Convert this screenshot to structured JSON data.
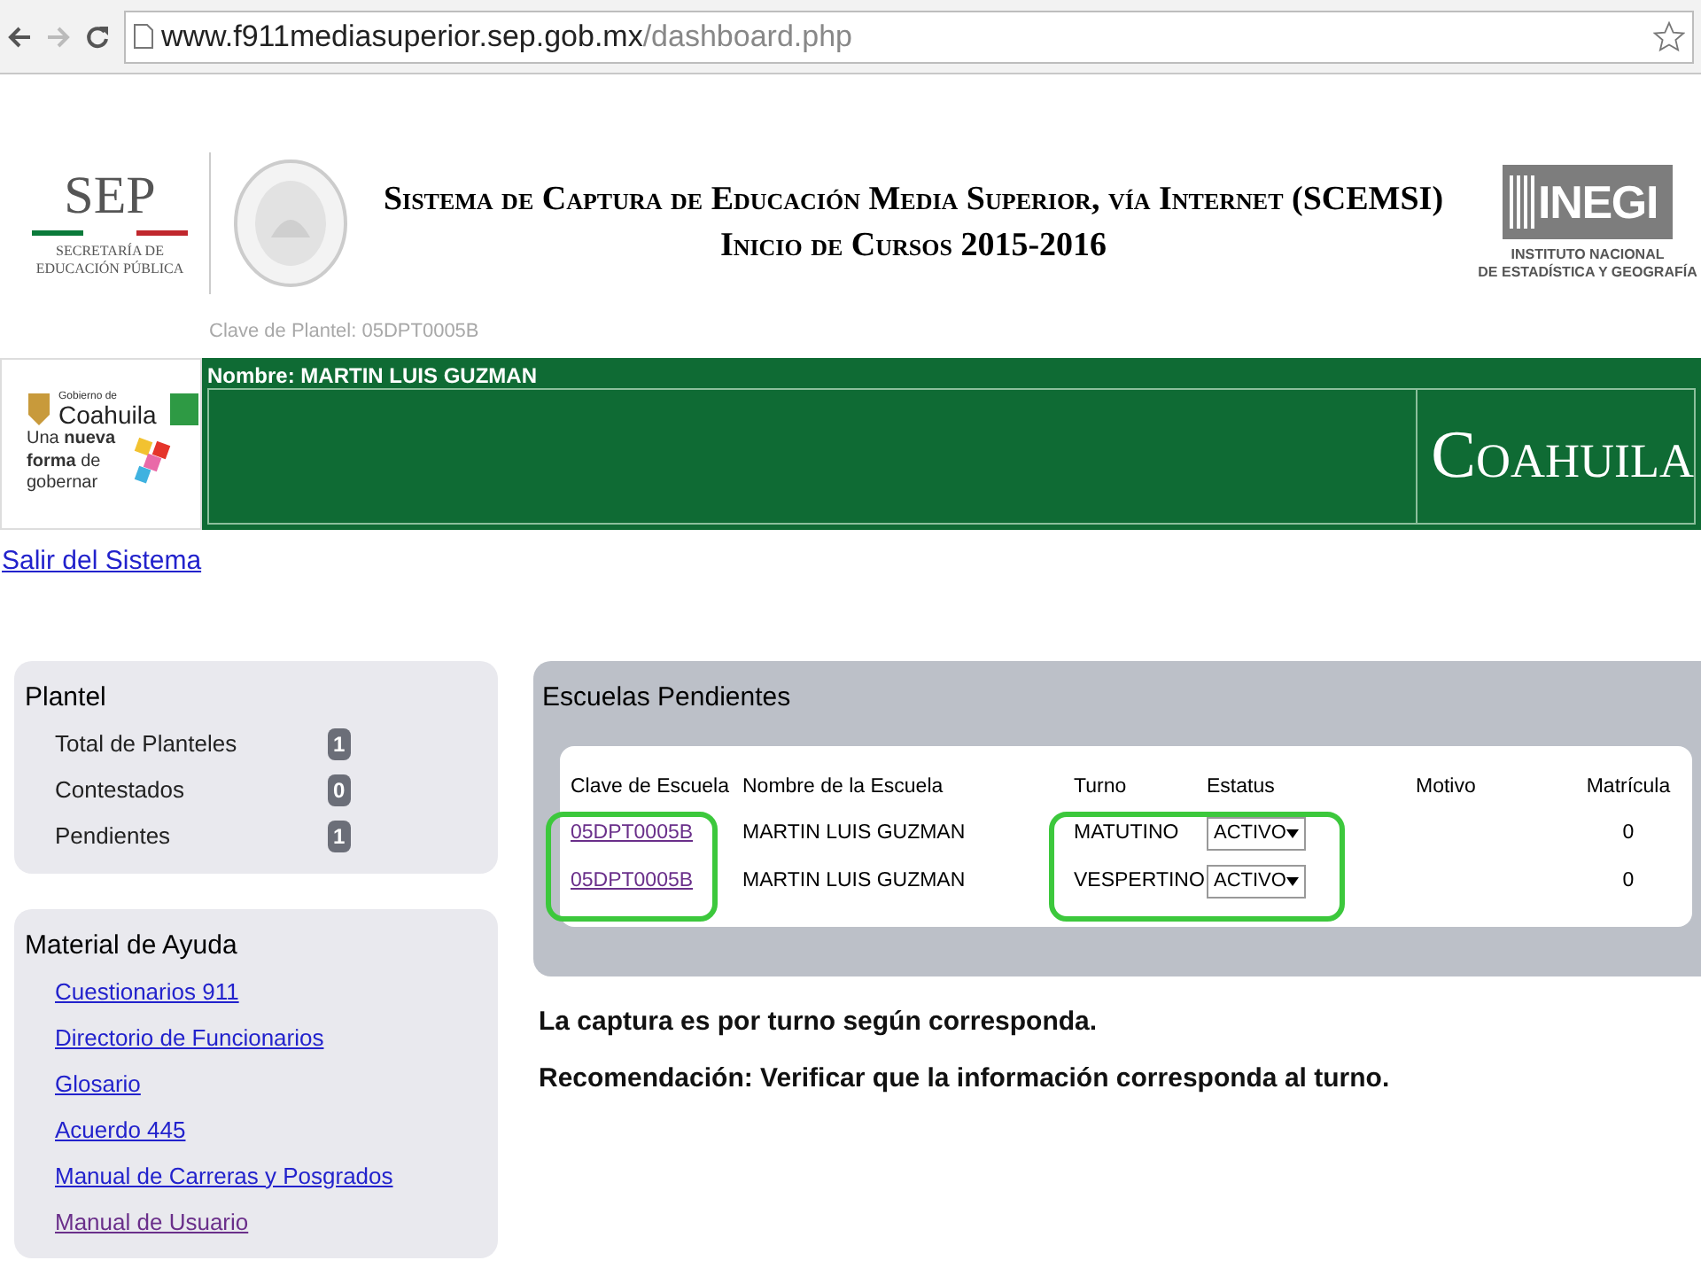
{
  "browser": {
    "url_host": "www.f911mediasuperior.sep.gob.mx",
    "url_path": "/dashboard.php"
  },
  "header": {
    "sep_logo": {
      "mark": "SEP",
      "lines": [
        "SECRETARÍA DE",
        "EDUCACIÓN PÚBLICA"
      ]
    },
    "title_lines": [
      "Sistema de Captura de Educación Media Superior, vía Internet (SCEMSI)",
      "Inicio de Cursos 2015-2016"
    ],
    "inegi_logo": {
      "mark": "INEGI",
      "lines": [
        "INSTITUTO NACIONAL",
        "DE ESTADÍSTICA Y GEOGRAFÍA"
      ]
    }
  },
  "faint_label": "Clave de Plantel: 05DPT0005B",
  "banner": {
    "state_logo": {
      "top": "Gobierno de",
      "name": "Coahuila",
      "slogan": "Una **nueva forma** de gobernar"
    },
    "user": "Nombre: MARTIN LUIS GUZMAN",
    "state": "Coahuila"
  },
  "logout_link": "Salir del Sistema",
  "plantel": {
    "title": "Plantel",
    "items": [
      {
        "label": "Total de Planteles",
        "count": "1"
      },
      {
        "label": "Contestados",
        "count": "0"
      },
      {
        "label": "Pendientes",
        "count": "1"
      }
    ]
  },
  "help": {
    "title": "Material de Ayuda",
    "links": [
      {
        "label": "Cuestionarios 911",
        "visited": false
      },
      {
        "label": "Directorio de Funcionarios",
        "visited": false
      },
      {
        "label": "Glosario",
        "visited": false
      },
      {
        "label": "Acuerdo 445",
        "visited": false
      },
      {
        "label": "Manual de Carreras y Posgrados",
        "visited": false
      },
      {
        "label": "Manual de Usuario",
        "visited": true
      }
    ]
  },
  "pending": {
    "title": "Escuelas Pendientes",
    "columns": [
      {
        "label": "Clave de Escuela",
        "highlighted": true
      },
      {
        "label": "Nombre de la Escuela",
        "highlighted": false
      },
      {
        "label": "Turno",
        "highlighted": true
      },
      {
        "label": "Estatus",
        "highlighted": true
      },
      {
        "label": "Motivo",
        "highlighted": false
      },
      {
        "label": "Matrícula",
        "highlighted": false
      }
    ],
    "rows": [
      {
        "clave": "05DPT0005B",
        "nombre": "MARTIN LUIS GUZMAN",
        "turno": "MATUTINO",
        "estatus": "ACTIVO",
        "matricula": "0"
      },
      {
        "clave": "05DPT0005B",
        "nombre": "MARTIN LUIS GUZMAN",
        "turno": "VESPERTINO",
        "estatus": "ACTIVO",
        "matricula": "0"
      }
    ]
  },
  "notes": [
    "La captura es por turno según corresponda.",
    "Recomendación: Verificar que la información corresponda al turno."
  ]
}
